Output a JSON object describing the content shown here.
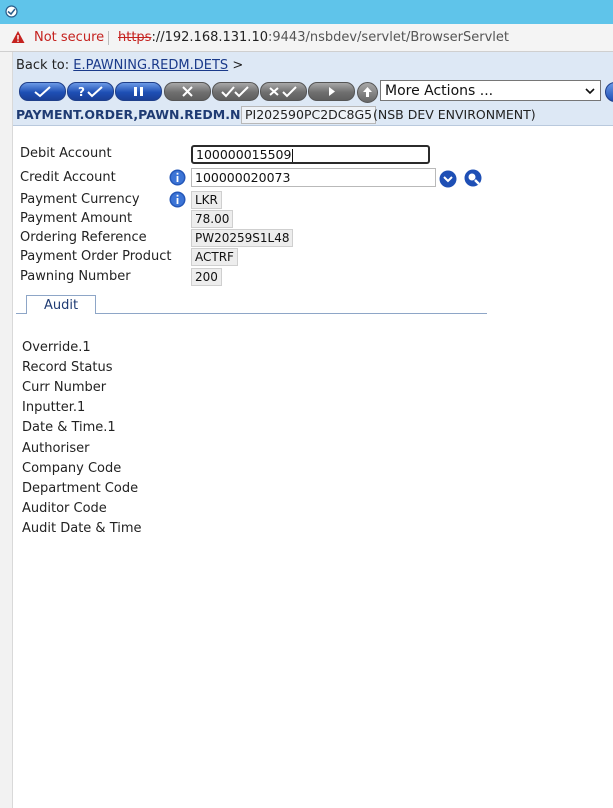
{
  "browser": {
    "not_secure": "Not secure",
    "url_scheme": "https",
    "url_rest": "://192.168.131.10",
    "url_port_path": ":9443/nsbdev/servlet/BrowserServlet"
  },
  "header": {
    "back_to_label": "Back to:",
    "back_to_link": "E.PAWNING.REDM.DETS",
    "back_to_arrow": ">",
    "more_actions": "More Actions ...",
    "application": "PAYMENT.ORDER,PAWN.REDM.NSB",
    "record_id": "PI202590PC2DC8G5",
    "environment": "(NSB DEV ENVIRONMENT)"
  },
  "toolbar": {
    "buttons": [
      {
        "icon": "commit-tick-icon",
        "state": "active"
      },
      {
        "icon": "validate-question-tick-icon",
        "state": "active"
      },
      {
        "icon": "hold-pause-icon",
        "state": "active"
      },
      {
        "icon": "delete-cross-icon",
        "state": "disabled"
      },
      {
        "icon": "authorise-double-tick-icon",
        "state": "disabled"
      },
      {
        "icon": "reverse-cross-tick-icon",
        "state": "disabled"
      },
      {
        "icon": "copy-arrow-icon",
        "state": "disabled"
      },
      {
        "icon": "upload-icon",
        "state": "disabled"
      }
    ]
  },
  "form": {
    "debit_account": {
      "label": "Debit Account",
      "value": "100000015509"
    },
    "credit_account": {
      "label": "Credit Account",
      "value": "100000020073"
    },
    "payment_currency": {
      "label": "Payment Currency",
      "value": "LKR"
    },
    "payment_amount": {
      "label": "Payment Amount",
      "value": "78.00"
    },
    "ordering_reference": {
      "label": "Ordering Reference",
      "value": "PW20259S1L48"
    },
    "payment_order_product": {
      "label": "Payment Order Product",
      "value": "ACTRF"
    },
    "pawning_number": {
      "label": "Pawning Number",
      "value": "200"
    }
  },
  "tabs": [
    {
      "label": "Audit"
    }
  ],
  "audit": {
    "fields": [
      "Override.1",
      "Record Status",
      "Curr Number",
      "Inputter.1",
      "Date & Time.1",
      "Authoriser",
      "Company Code",
      "Department Code",
      "Auditor Code",
      "Audit Date & Time"
    ]
  },
  "colors": {
    "titlebar": "#5fc4ea",
    "toolbar_bg": "#dde8f5",
    "active_button": "#1e4fb5",
    "warning_red": "#c5221f"
  }
}
